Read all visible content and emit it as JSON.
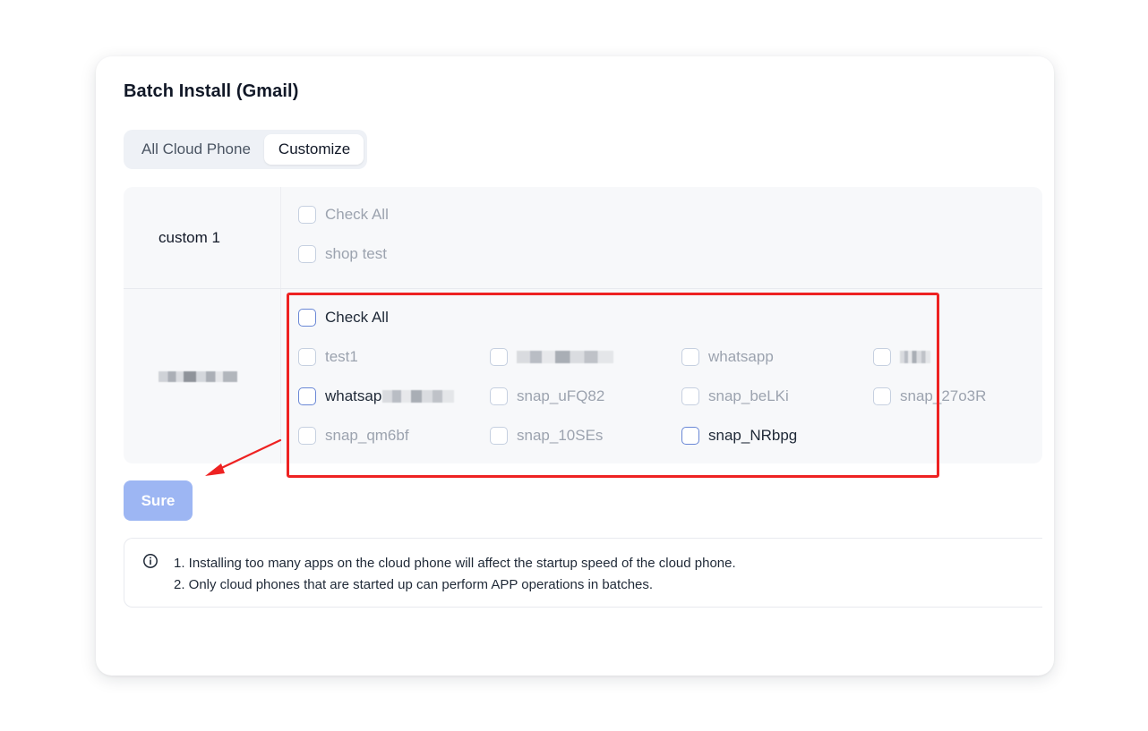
{
  "dialog": {
    "title": "Batch Install (Gmail)"
  },
  "tabs": [
    {
      "label": "All Cloud Phone",
      "active": false
    },
    {
      "label": "Customize",
      "active": true
    }
  ],
  "groups": [
    {
      "name": "custom 1",
      "check_all": "Check All",
      "items": [
        "shop test"
      ]
    },
    {
      "name": "",
      "name_blurred": true,
      "check_all": "Check All",
      "items": [
        "test1",
        "",
        "whatsapp",
        "",
        "whatsap",
        "snap_uFQ82",
        "snap_beLKi",
        "snap_27o3R",
        "snap_qm6bf",
        "snap_10SEs",
        "snap_NRbpg"
      ]
    }
  ],
  "actions": {
    "sure_label": "Sure"
  },
  "notice": {
    "icon": "info-circle-icon",
    "lines": [
      "1. Installing too many apps on the cloud phone will affect the startup speed of the cloud phone.",
      "2. Only cloud phones that are started up can perform APP operations in batches."
    ]
  },
  "colors": {
    "primary_disabled": "#9db6f3",
    "annotation_red": "#ee2222",
    "group_bg": "#f7f8fa"
  }
}
